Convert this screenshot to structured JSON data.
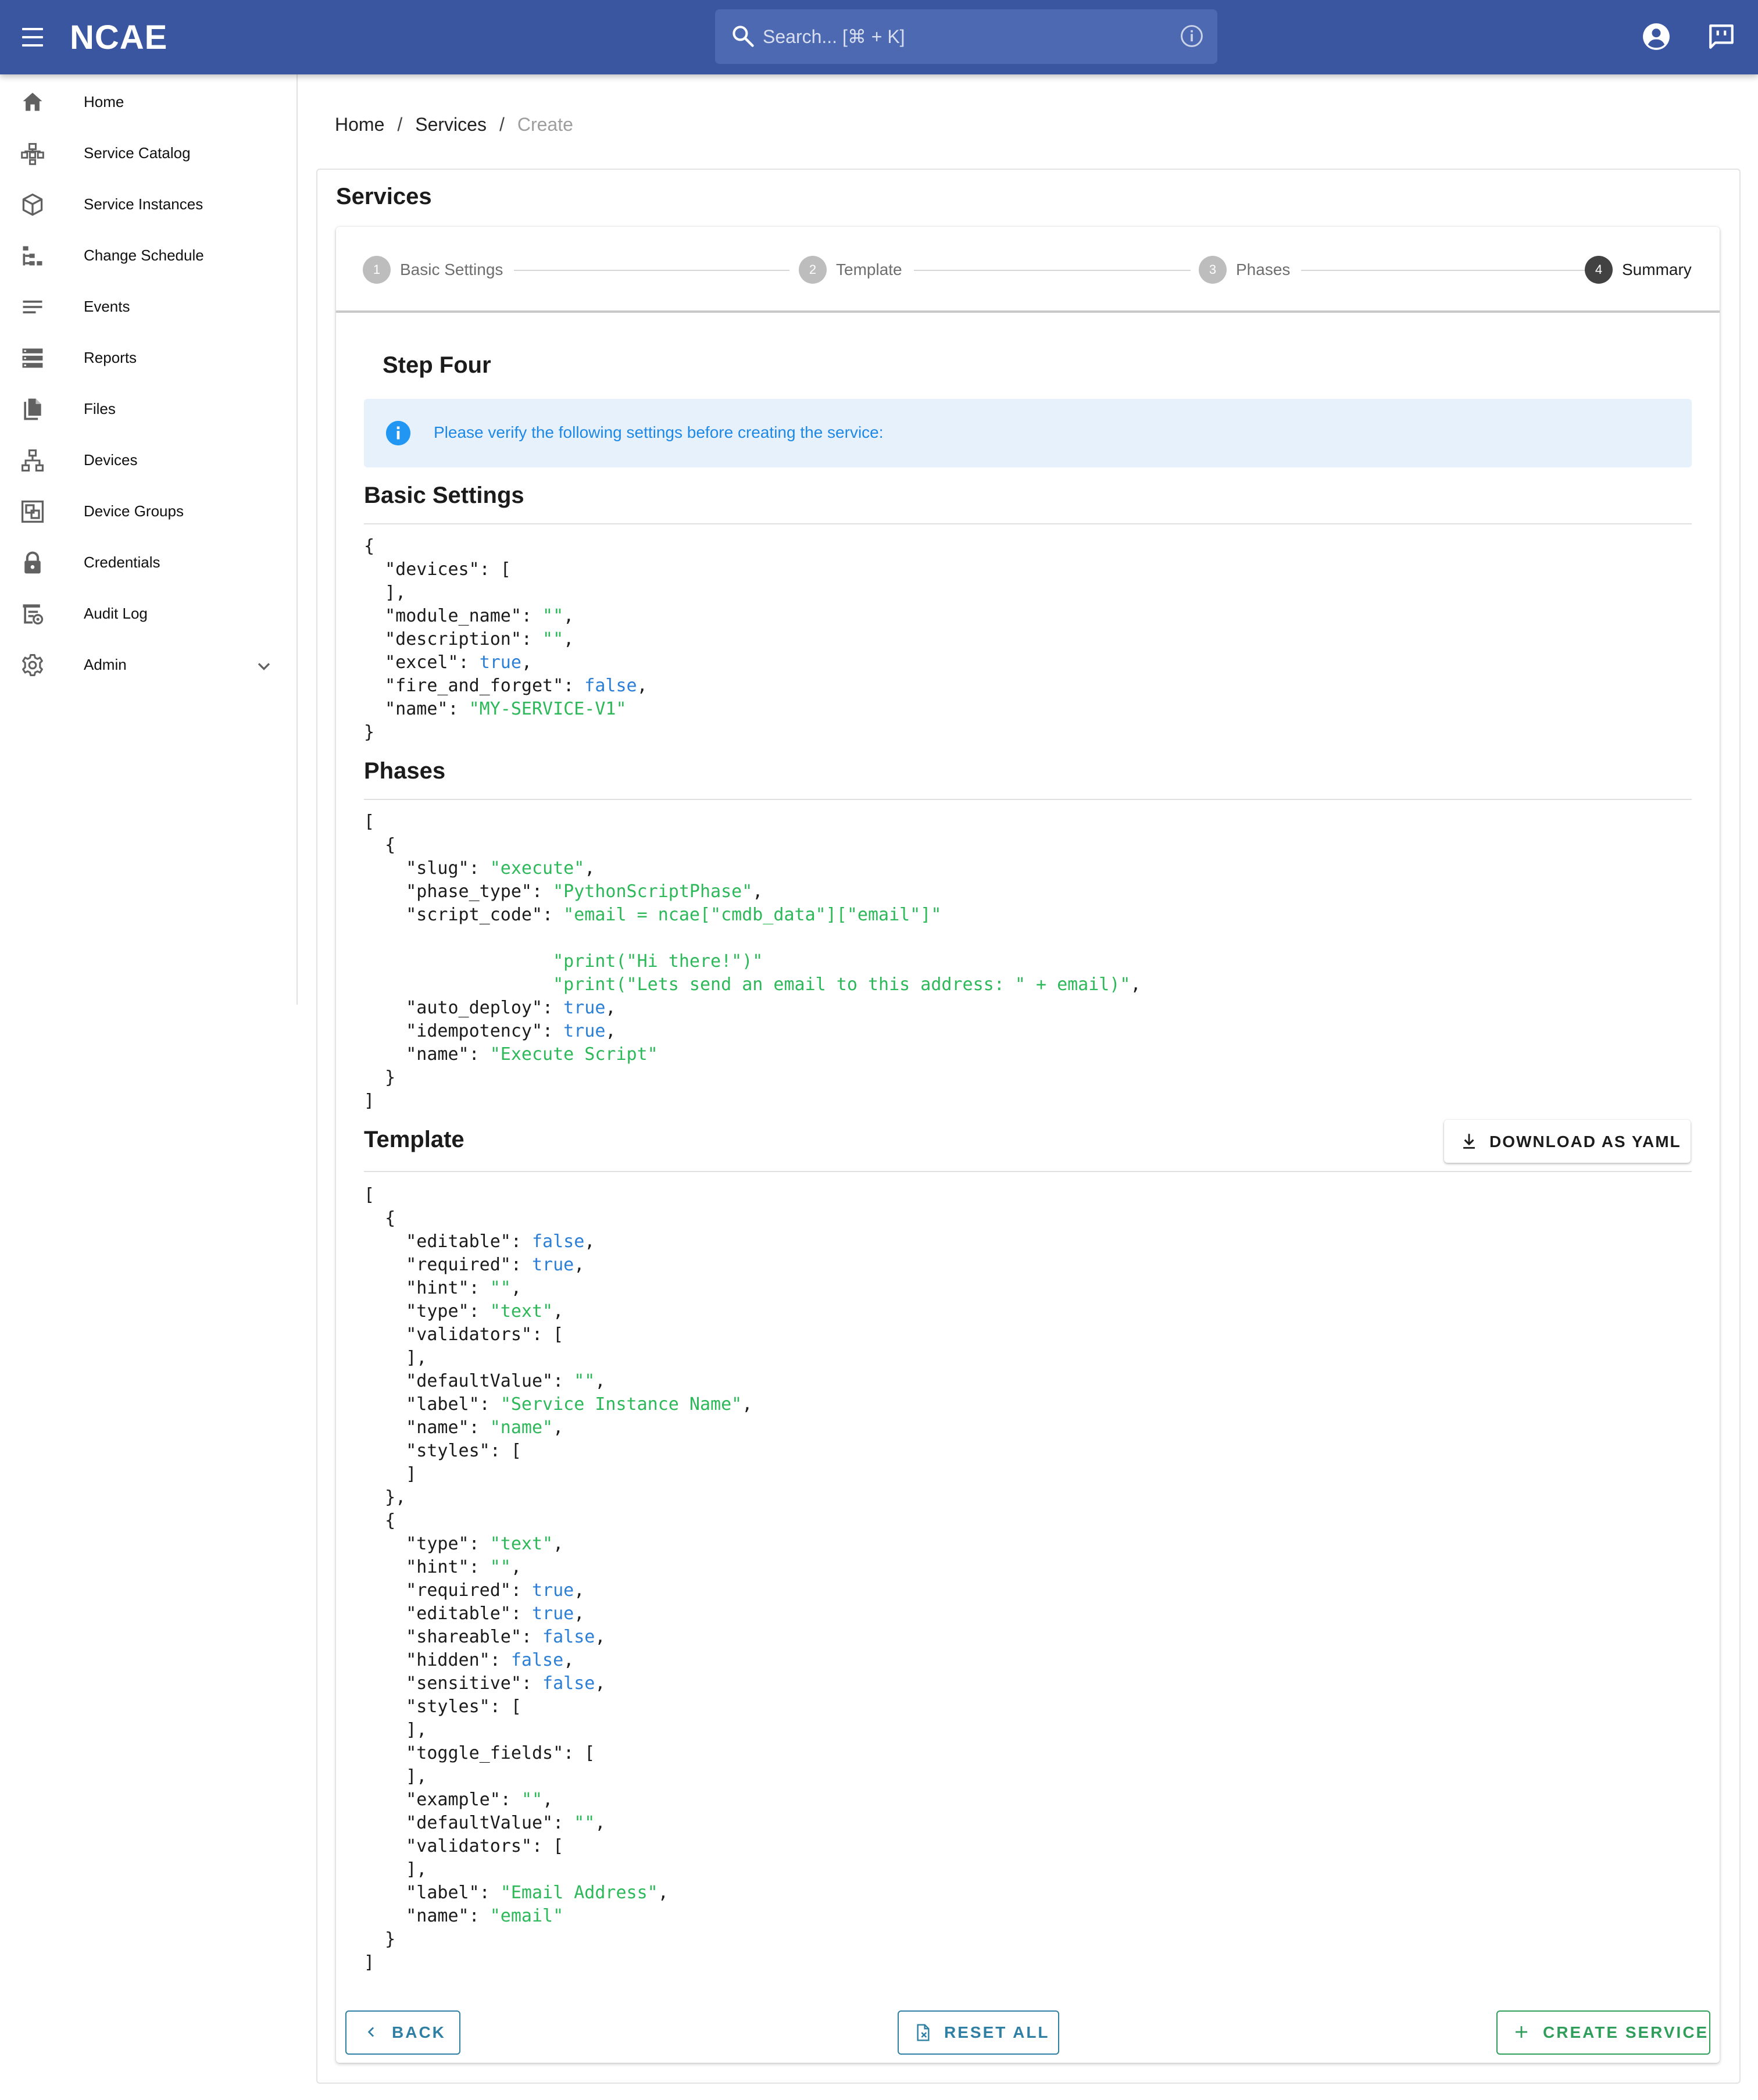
{
  "app": {
    "logo_text": "NCAE",
    "search_placeholder": "Search... [⌘ + K]"
  },
  "sidebar": {
    "items": [
      {
        "label": "Home",
        "icon": "home-icon"
      },
      {
        "label": "Service Catalog",
        "icon": "service-catalog-icon"
      },
      {
        "label": "Service Instances",
        "icon": "cube-icon"
      },
      {
        "label": "Change Schedule",
        "icon": "tree-schedule-icon"
      },
      {
        "label": "Events",
        "icon": "list-lines-icon"
      },
      {
        "label": "Reports",
        "icon": "storage-rows-icon"
      },
      {
        "label": "Files",
        "icon": "file-copy-icon"
      },
      {
        "label": "Devices",
        "icon": "network-devices-icon"
      },
      {
        "label": "Device Groups",
        "icon": "device-groups-icon"
      },
      {
        "label": "Credentials",
        "icon": "lock-icon"
      },
      {
        "label": "Audit Log",
        "icon": "audit-log-icon"
      },
      {
        "label": "Admin",
        "icon": "gear-icon"
      }
    ]
  },
  "breadcrumb": {
    "home": "Home",
    "services": "Services",
    "current": "Create",
    "sep": "/"
  },
  "page": {
    "title": "Services"
  },
  "stepper": {
    "steps": [
      {
        "num": "1",
        "label": "Basic Settings"
      },
      {
        "num": "2",
        "label": "Template"
      },
      {
        "num": "3",
        "label": "Phases"
      },
      {
        "num": "4",
        "label": "Summary"
      }
    ],
    "active_step": 4
  },
  "summary": {
    "step_title": "Step Four",
    "alert": "Please verify the following settings before creating the service:",
    "basic_settings_title": "Basic Settings",
    "phases_title": "Phases",
    "template_title": "Template",
    "download_label": "DOWNLOAD AS YAML"
  },
  "basic_settings": {
    "module_name": "",
    "description": "",
    "excel": "true",
    "fire_and_forget": "false",
    "name": "MY-SERVICE-V1"
  },
  "phases": [
    {
      "slug": "execute",
      "phase_type": "PythonScriptPhase",
      "script_line1": "email = ncae[\"cmdb_data\"][\"email\"]",
      "script_line2": "print(\"Hi there!\")",
      "script_line3": "print(\"Lets send an email to this address: \" + email)",
      "auto_deploy": "true",
      "idempotency": "true",
      "name": "Execute Script"
    }
  ],
  "template": [
    {
      "editable": "false",
      "required": "true",
      "hint": "",
      "type": "text",
      "defaultValue": "",
      "label": "Service Instance Name",
      "name": "name"
    },
    {
      "type": "text",
      "hint": "",
      "required": "true",
      "editable": "true",
      "shareable": "false",
      "hidden": "false",
      "sensitive": "false",
      "example": "",
      "defaultValue": "",
      "label": "Email Address",
      "name": "email"
    }
  ],
  "actions": {
    "back": "BACK",
    "reset": "RESET ALL",
    "create": "CREATE SERVICE"
  },
  "colors": {
    "appbar": "#3a56a1",
    "json_string": "#2db85a",
    "json_boolean": "#2b7fd6",
    "back_button": "#2e7fa3",
    "create_button": "#2f9e5a"
  }
}
